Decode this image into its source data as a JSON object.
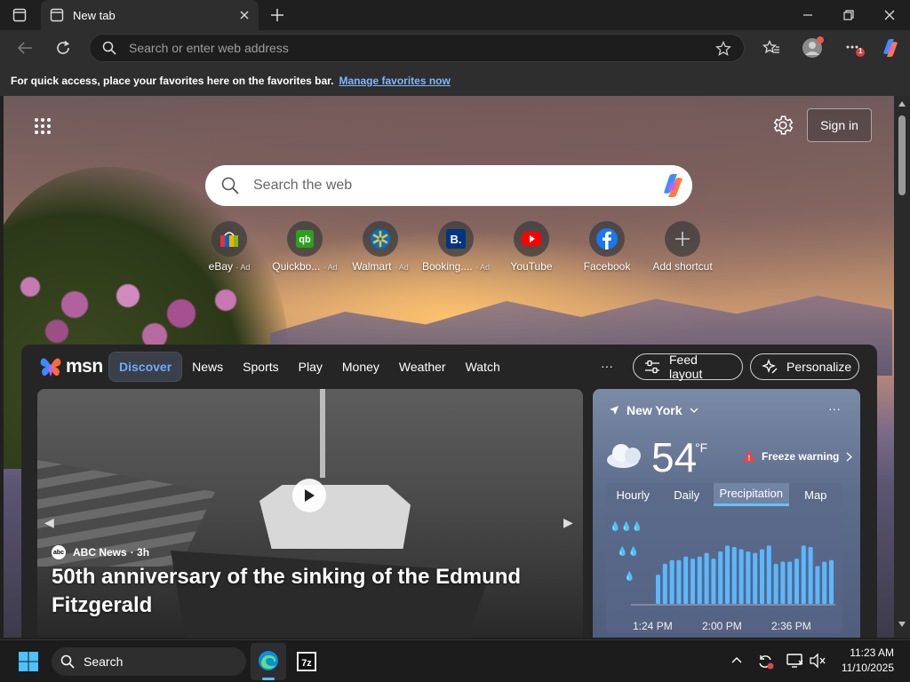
{
  "browser": {
    "tab_title": "New tab",
    "address_placeholder": "Search or enter web address",
    "profile_badge": "1"
  },
  "favorites_hint": {
    "text": "For quick access, place your favorites here on the favorites bar.",
    "link": "Manage favorites now"
  },
  "newtab": {
    "signin_label": "Sign in",
    "search_placeholder": "Search the web",
    "shortcuts": [
      {
        "label": "eBay",
        "ad": "· Ad",
        "icon": "ebay-icon",
        "color": "#e53238"
      },
      {
        "label": "Quickbo...",
        "ad": "· Ad",
        "icon": "quickbooks-icon",
        "color": "#2ca01c"
      },
      {
        "label": "Walmart",
        "ad": "· Ad",
        "icon": "walmart-icon",
        "color": "#0071ce"
      },
      {
        "label": "Booking....",
        "ad": "· Ad",
        "icon": "booking-icon",
        "color": "#003580"
      },
      {
        "label": "YouTube",
        "ad": "",
        "icon": "youtube-icon",
        "color": "#ff0000"
      },
      {
        "label": "Facebook",
        "ad": "",
        "icon": "facebook-icon",
        "color": "#1877f2"
      },
      {
        "label": "Add shortcut",
        "ad": "",
        "icon": "plus-icon",
        "color": "#cccccc"
      }
    ]
  },
  "feed": {
    "brand": "msn",
    "nav": [
      "Discover",
      "News",
      "Sports",
      "Play",
      "Money",
      "Weather",
      "Watch"
    ],
    "more": "···",
    "feed_layout_label": "Feed layout",
    "personalize_label": "Personalize",
    "hero": {
      "source": "ABC News",
      "source_badge": "abc",
      "age": "· 3h",
      "headline": "50th anniversary of the sinking of the Edmund Fitzgerald"
    },
    "weather": {
      "location": "New York",
      "temp": "54",
      "unit": "°F",
      "alert": "Freeze warning",
      "tabs": [
        "Hourly",
        "Daily",
        "Precipitation",
        "Map"
      ],
      "active_tab": "Precipitation",
      "times": [
        "1:24 PM",
        "2:00 PM",
        "2:36 PM"
      ],
      "precip_bars": [
        0.4,
        0.55,
        0.6,
        0.6,
        0.65,
        0.62,
        0.65,
        0.7,
        0.62,
        0.72,
        0.8,
        0.78,
        0.75,
        0.72,
        0.7,
        0.75,
        0.8,
        0.55,
        0.58,
        0.58,
        0.62,
        0.8,
        0.78,
        0.52,
        0.58,
        0.6
      ]
    }
  },
  "taskbar": {
    "search_label": "Search",
    "time": "11:23 AM",
    "date": "11/10/2025"
  },
  "colors": {
    "accent_link": "#7fb7ff",
    "msn_active": "#6ea8ff",
    "precip_bar": "#5bb8ff"
  }
}
